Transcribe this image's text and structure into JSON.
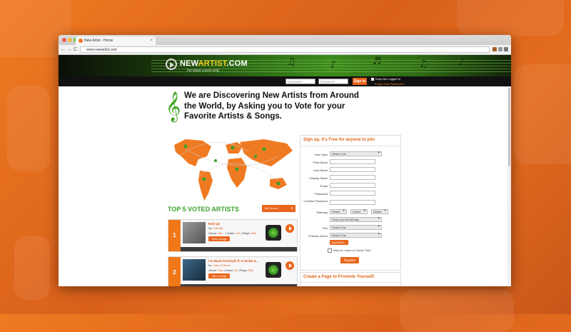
{
  "colors": {
    "accent_orange": "#e9661c",
    "brand_green": "#3aa22a",
    "header_dark": "#0b0f08"
  },
  "browser": {
    "tab_title": "New Artist - Home",
    "tab_close": "×",
    "url": "www.newartist.com",
    "back_icon": "←",
    "forward_icon": "→",
    "reload_icon": "C"
  },
  "header": {
    "logo_part1": "NEW",
    "logo_part2": "ARTIST",
    "logo_part3": ".COM",
    "tagline": "For Music Lovers Only",
    "username_placeholder": "Username",
    "password_placeholder": "Password",
    "signin_label": "Sign In",
    "keep_logged_in": "Keep Me Logged In",
    "forgot_password": "Forgot Your Password?"
  },
  "hero": {
    "line1": "We are Discovering New Artists from Around",
    "line2": "the World, by Asking you to Vote for your",
    "line3": "Favorite Artists & Songs."
  },
  "top5": {
    "title": "TOP 5 VOTED ARTISTS",
    "filter_label": "All Genres",
    "artists": [
      {
        "rank": "1",
        "title": "Roll Up",
        "by_label": "By:",
        "artist": "Cdt Bat",
        "genre_label": "Genre:",
        "genre": "Hip...",
        "votes_label": "Votes:",
        "votes": "112",
        "plays_label": "Plays:",
        "plays": "558",
        "button": "View Songs"
      },
      {
        "rank": "2",
        "title": "I'm Back Freestyle ft. K-Dude &...",
        "by_label": "By:",
        "artist": "John 3 Times",
        "genre_label": "Genre:",
        "genre": "Rap",
        "votes_label": "Votes:",
        "votes": "60",
        "plays_label": "Plays:",
        "plays": "556",
        "button": "View Songs"
      }
    ]
  },
  "signup": {
    "title": "Sign up, it's Free for anyone to join",
    "fields": {
      "user_type": "User Type",
      "first_name": "First Name",
      "last_name": "Last Name",
      "display_name": "Display Name",
      "email": "Email",
      "password": "Password",
      "confirm_password": "Confirm Password",
      "birthday": "Birthday",
      "sex": "Sex",
      "primary_genre": "Primary Genre"
    },
    "required_mark": "*",
    "select_one": "Select One",
    "select": "Select",
    "show_birthday": "Show my full birthday",
    "add_more": "Add More...",
    "check_question": "Why do I have to Check This?",
    "register": "Register"
  },
  "promo": {
    "title": "Create a Page to Promote Yourself:"
  }
}
